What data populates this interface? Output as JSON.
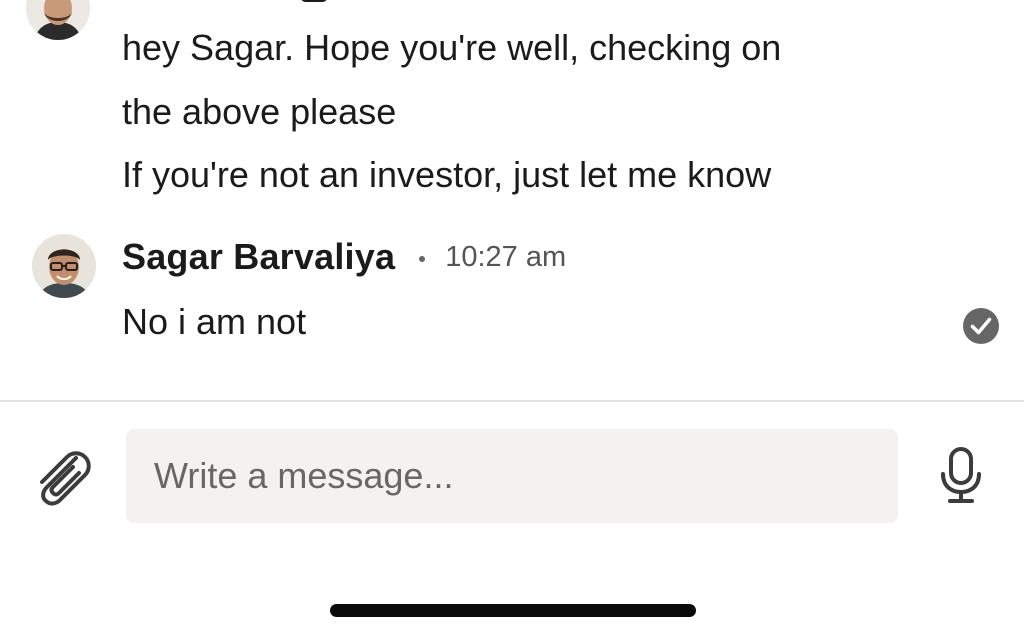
{
  "messages": {
    "previous": {
      "avatar_icon": "person-avatar",
      "lines": [
        "hey Sagar. Hope you're well, checking on",
        "the above please",
        "If you're not an investor, just let me know"
      ]
    },
    "reply": {
      "sender": "Sagar Barvaliya",
      "time": "10:27 am",
      "avatar_icon": "person-avatar",
      "text": "No i am not",
      "status_icon": "read-receipt-check-icon"
    }
  },
  "composer": {
    "placeholder": "Write a message...",
    "value": "",
    "attach_icon": "paperclip-icon",
    "voice_icon": "microphone-icon"
  },
  "colors": {
    "text": "#1b1b1b",
    "muted": "#555555",
    "input_bg": "#f3f2ef",
    "divider": "#e3e3e3",
    "receipt": "#666666",
    "badge": "#c98a1a"
  }
}
